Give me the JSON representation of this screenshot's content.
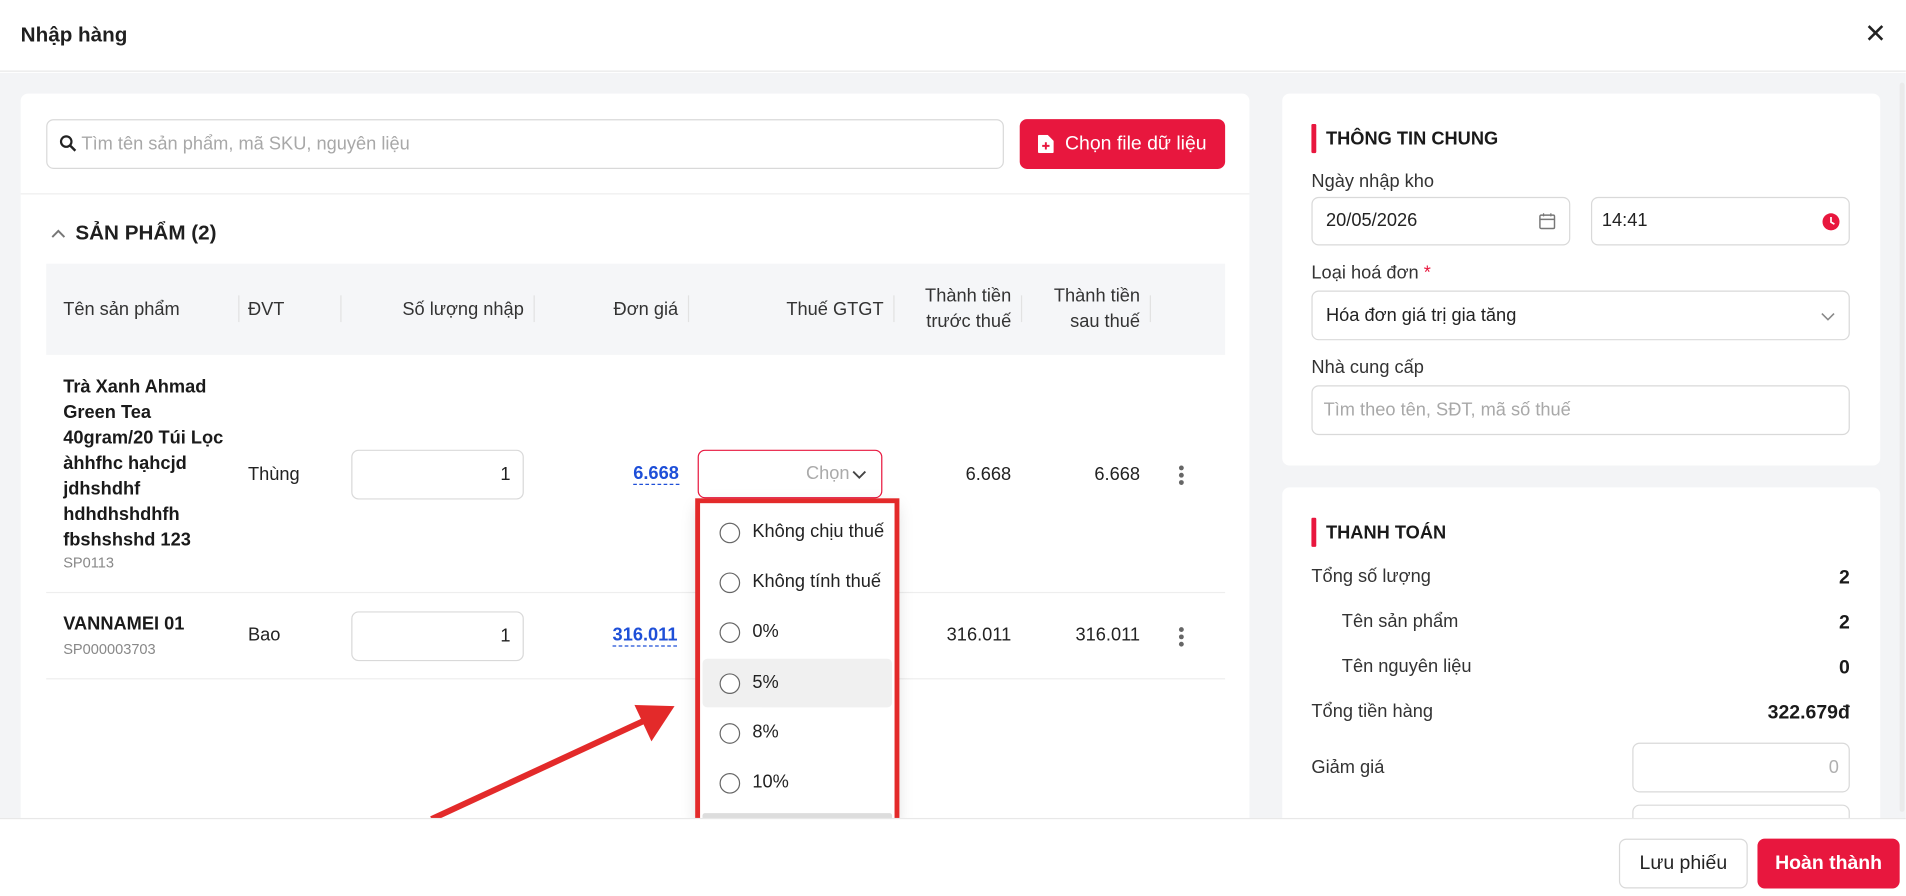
{
  "modal": {
    "title": "Nhập hàng"
  },
  "search": {
    "placeholder": "Tìm tên sản phẩm, mã SKU, nguyên liệu"
  },
  "choose_file_label": "Chọn file dữ liệu",
  "products": {
    "section_title": "SẢN PHẨM (2)",
    "columns": {
      "name": "Tên sản phẩm",
      "unit": "ĐVT",
      "qty": "Số lượng nhập",
      "price": "Đơn giá",
      "tax": "Thuế GTGT",
      "pre_tax_1": "Thành tiền",
      "pre_tax_2": "trước thuế",
      "post_tax_1": "Thành tiền",
      "post_tax_2": "sau thuế"
    },
    "rows": [
      {
        "name_lines": [
          "Trà Xanh Ahmad",
          "Green Tea",
          "40gram/20 Túi Lọc",
          "àhhfhc hạhcjd",
          "jdhshdhf",
          "hdhdhshdhfh",
          "fbshshshd 123"
        ],
        "sku": "SP0113",
        "unit": "Thùng",
        "qty": "1",
        "price": "6.668",
        "tax_placeholder": "Chọn",
        "pre_tax": "6.668",
        "post_tax": "6.668"
      },
      {
        "name_lines": [
          "VANNAMEI 01"
        ],
        "sku": "SP000003703",
        "unit": "Bao",
        "qty": "1",
        "price": "316.011",
        "pre_tax": "316.011",
        "post_tax": "316.011"
      }
    ]
  },
  "tax_options": [
    "Không chịu thuế",
    "Không tính thuế",
    "0%",
    "5%",
    "8%",
    "10%"
  ],
  "general_info": {
    "title": "THÔNG TIN CHUNG",
    "date_label": "Ngày nhập kho",
    "date": "20/05/2026",
    "time": "14:41",
    "invoice_label": "Loại hoá đơn",
    "required_mark": "*",
    "invoice_value": "Hóa đơn giá trị gia tăng",
    "supplier_label": "Nhà cung cấp",
    "supplier_placeholder": "Tìm theo tên, SĐT, mã số thuế"
  },
  "payment": {
    "title": "THANH TOÁN",
    "total_qty_label": "Tổng số lượng",
    "total_qty": "2",
    "product_label": "Tên sản phẩm",
    "product_count": "2",
    "material_label": "Tên nguyên liệu",
    "material_count": "0",
    "total_amount_label": "Tổng tiền hàng",
    "total_amount": "322.679đ",
    "discount_label": "Giảm giá",
    "discount_placeholder": "0"
  },
  "footer": {
    "save_label": "Lưu phiếu",
    "complete_label": "Hoàn thành"
  },
  "colors": {
    "accent": "#e8173e",
    "link": "#1e4fd8",
    "annotation": "#e32a2a"
  }
}
